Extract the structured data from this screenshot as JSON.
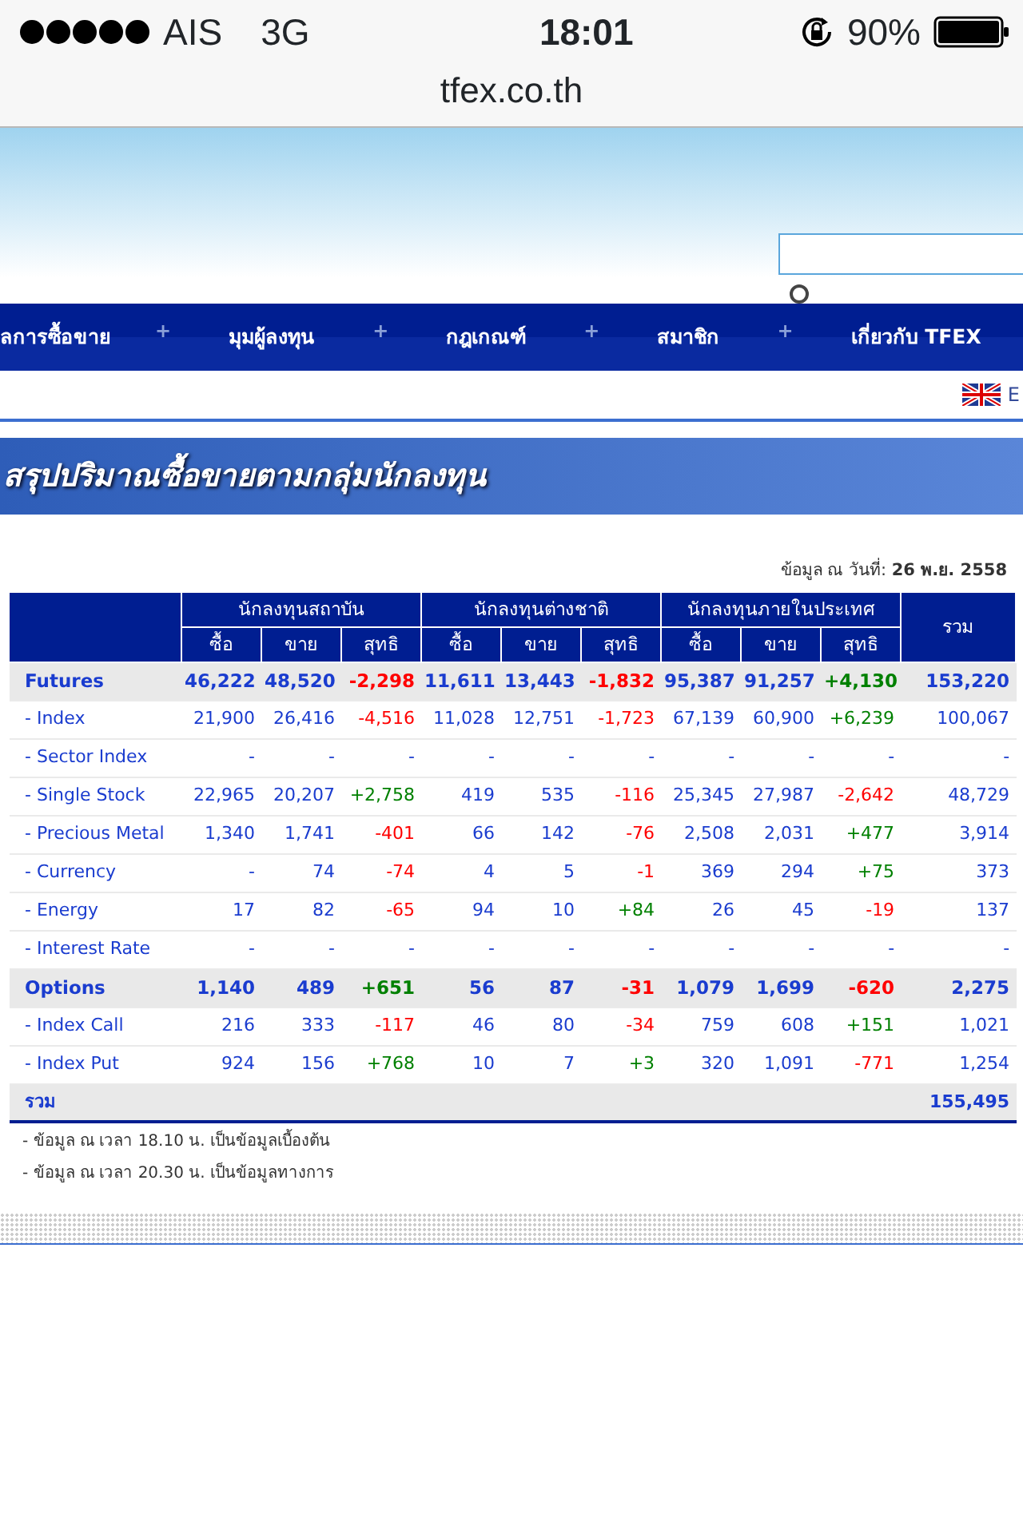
{
  "status_bar": {
    "carrier": "AIS",
    "network": "3G",
    "time": "18:01",
    "battery": "90%"
  },
  "browser": {
    "url": "tfex.co.th"
  },
  "nav": {
    "items": [
      "ลการซื้อขาย",
      "มุมผู้ลงทุน",
      "กฎเกณฑ์",
      "สมาชิก",
      "เกี่ยวกับ TFEX"
    ],
    "separators": [
      "+",
      "+",
      "+",
      "+"
    ]
  },
  "language": {
    "label": "E"
  },
  "banner": {
    "title": "สรุปปริมาณซื้อขายตามกลุ่มนักลงทุน"
  },
  "date_line": {
    "label": "ข้อมูล ณ วันที่:",
    "value": "26 พ.ย. 2558"
  },
  "table": {
    "groups": [
      "นักลงทุนสถาบัน",
      "นักลงทุนต่างชาติ",
      "นักลงทุนภายในประเทศ"
    ],
    "sub_columns": [
      "ซื้อ",
      "ขาย",
      "สุทธิ",
      "ซื้อ",
      "ขาย",
      "สุทธิ",
      "ซื้อ",
      "ขาย",
      "สุทธิ"
    ],
    "total_column": "รวม",
    "rows": [
      {
        "kind": "group",
        "label": "Futures",
        "cells": [
          {
            "text": "46,222"
          },
          {
            "text": "48,520"
          },
          {
            "text": "-2,298",
            "color": "#ff0000"
          },
          {
            "text": "11,611"
          },
          {
            "text": "13,443"
          },
          {
            "text": "-1,832",
            "color": "#ff0000"
          },
          {
            "text": "95,387"
          },
          {
            "text": "91,257"
          },
          {
            "text": "+4,130",
            "color": "#008000"
          },
          {
            "text": "153,220"
          }
        ]
      },
      {
        "kind": "item",
        "label": "- Index",
        "cells": [
          {
            "text": "21,900"
          },
          {
            "text": "26,416"
          },
          {
            "text": "-4,516",
            "color": "#ff0000"
          },
          {
            "text": "11,028"
          },
          {
            "text": "12,751"
          },
          {
            "text": "-1,723",
            "color": "#ff0000"
          },
          {
            "text": "67,139"
          },
          {
            "text": "60,900"
          },
          {
            "text": "+6,239",
            "color": "#008000"
          },
          {
            "text": "100,067"
          }
        ]
      },
      {
        "kind": "item",
        "label": "- Sector Index",
        "cells": [
          {
            "text": "-"
          },
          {
            "text": "-"
          },
          {
            "text": "-"
          },
          {
            "text": "-"
          },
          {
            "text": "-"
          },
          {
            "text": "-"
          },
          {
            "text": "-"
          },
          {
            "text": "-"
          },
          {
            "text": "-"
          },
          {
            "text": "-"
          }
        ]
      },
      {
        "kind": "item",
        "label": "- Single Stock",
        "cells": [
          {
            "text": "22,965"
          },
          {
            "text": "20,207"
          },
          {
            "text": "+2,758",
            "color": "#008000"
          },
          {
            "text": "419"
          },
          {
            "text": "535"
          },
          {
            "text": "-116",
            "color": "#ff0000"
          },
          {
            "text": "25,345"
          },
          {
            "text": "27,987"
          },
          {
            "text": "-2,642",
            "color": "#ff0000"
          },
          {
            "text": "48,729"
          }
        ]
      },
      {
        "kind": "item",
        "label": "- Precious Metal",
        "cells": [
          {
            "text": "1,340"
          },
          {
            "text": "1,741"
          },
          {
            "text": "-401",
            "color": "#ff0000"
          },
          {
            "text": "66"
          },
          {
            "text": "142"
          },
          {
            "text": "-76",
            "color": "#ff0000"
          },
          {
            "text": "2,508"
          },
          {
            "text": "2,031"
          },
          {
            "text": "+477",
            "color": "#008000"
          },
          {
            "text": "3,914"
          }
        ]
      },
      {
        "kind": "item",
        "label": "- Currency",
        "cells": [
          {
            "text": "-"
          },
          {
            "text": "74"
          },
          {
            "text": "-74",
            "color": "#ff0000"
          },
          {
            "text": "4"
          },
          {
            "text": "5"
          },
          {
            "text": "-1",
            "color": "#ff0000"
          },
          {
            "text": "369"
          },
          {
            "text": "294"
          },
          {
            "text": "+75",
            "color": "#008000"
          },
          {
            "text": "373"
          }
        ]
      },
      {
        "kind": "item",
        "label": "- Energy",
        "cells": [
          {
            "text": "17"
          },
          {
            "text": "82"
          },
          {
            "text": "-65",
            "color": "#ff0000"
          },
          {
            "text": "94"
          },
          {
            "text": "10"
          },
          {
            "text": "+84",
            "color": "#008000"
          },
          {
            "text": "26"
          },
          {
            "text": "45"
          },
          {
            "text": "-19",
            "color": "#ff0000"
          },
          {
            "text": "137"
          }
        ]
      },
      {
        "kind": "item",
        "label": "- Interest Rate",
        "cells": [
          {
            "text": "-"
          },
          {
            "text": "-"
          },
          {
            "text": "-"
          },
          {
            "text": "-"
          },
          {
            "text": "-"
          },
          {
            "text": "-"
          },
          {
            "text": "-"
          },
          {
            "text": "-"
          },
          {
            "text": "-"
          },
          {
            "text": "-"
          }
        ]
      },
      {
        "kind": "group",
        "label": "Options",
        "cells": [
          {
            "text": "1,140"
          },
          {
            "text": "489"
          },
          {
            "text": "+651",
            "color": "#008000"
          },
          {
            "text": "56"
          },
          {
            "text": "87"
          },
          {
            "text": "-31",
            "color": "#ff0000"
          },
          {
            "text": "1,079"
          },
          {
            "text": "1,699"
          },
          {
            "text": "-620",
            "color": "#ff0000"
          },
          {
            "text": "2,275"
          }
        ]
      },
      {
        "kind": "item",
        "label": "- Index Call",
        "cells": [
          {
            "text": "216"
          },
          {
            "text": "333"
          },
          {
            "text": "-117",
            "color": "#ff0000"
          },
          {
            "text": "46"
          },
          {
            "text": "80"
          },
          {
            "text": "-34",
            "color": "#ff0000"
          },
          {
            "text": "759"
          },
          {
            "text": "608"
          },
          {
            "text": "+151",
            "color": "#008000"
          },
          {
            "text": "1,021"
          }
        ]
      },
      {
        "kind": "item",
        "label": "- Index Put",
        "cells": [
          {
            "text": "924"
          },
          {
            "text": "156"
          },
          {
            "text": "+768",
            "color": "#008000"
          },
          {
            "text": "10"
          },
          {
            "text": "7"
          },
          {
            "text": "+3",
            "color": "#008000"
          },
          {
            "text": "320"
          },
          {
            "text": "1,091"
          },
          {
            "text": "-771",
            "color": "#ff0000"
          },
          {
            "text": "1,254"
          }
        ]
      }
    ],
    "total_row": {
      "label": "รวม",
      "value": "155,495"
    }
  },
  "notes": [
    "- ข้อมูล ณ เวลา 18.10 น. เป็นข้อมูลเบื้องต้น",
    "- ข้อมูล ณ เวลา 20.30 น. เป็นข้อมูลทางการ"
  ]
}
